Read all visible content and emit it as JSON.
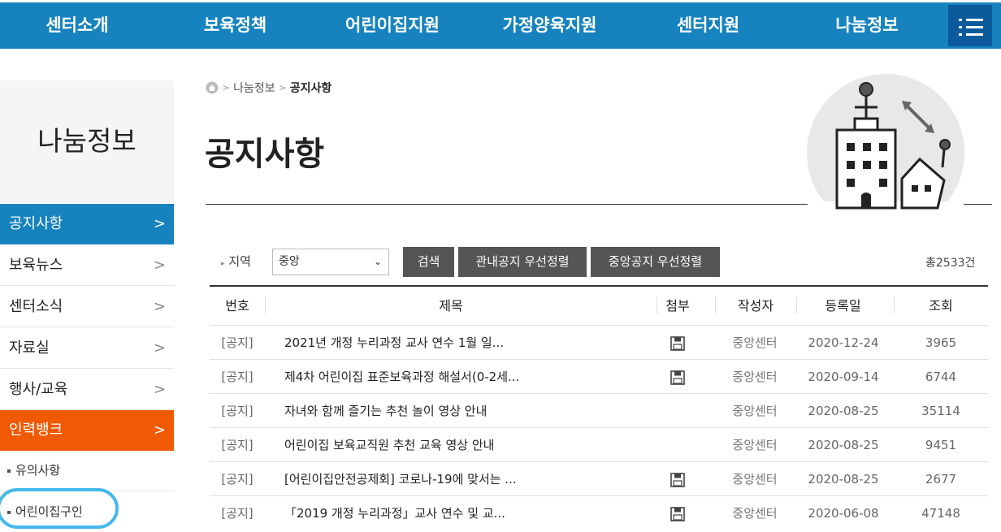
{
  "top_nav": {
    "items": [
      "센터소개",
      "보육정책",
      "어린이집지원",
      "가정양육지원",
      "센터지원",
      "나눔정보"
    ]
  },
  "sidebar": {
    "title": "나눔정보",
    "items": [
      {
        "label": "공지사항",
        "chevron": ">"
      },
      {
        "label": "보육뉴스",
        "chevron": ">"
      },
      {
        "label": "센터소식",
        "chevron": ">"
      },
      {
        "label": "자료실",
        "chevron": ">"
      },
      {
        "label": "행사/교육",
        "chevron": ">"
      },
      {
        "label": "인력뱅크",
        "chevron": ">"
      }
    ],
    "subitems": [
      {
        "label": "유의사항"
      },
      {
        "label": "어린이집구인"
      }
    ]
  },
  "breadcrumb": {
    "sep1": ">",
    "parent": "나눔정보",
    "sep2": ">",
    "current": "공지사항"
  },
  "page": {
    "title": "공지사항"
  },
  "filter": {
    "region_label": "지역",
    "region_value": "중앙",
    "caret": "⌄",
    "search_button": "검색",
    "sort_local_button": "관내공지 우선정렬",
    "sort_central_button": "중앙공지 우선정렬",
    "total": "총2533건"
  },
  "table": {
    "headers": {
      "num": "번호",
      "title": "제목",
      "attach": "첨부",
      "author": "작성자",
      "date": "등록일",
      "views": "조회"
    },
    "rows": [
      {
        "num": "[공지]",
        "title": "2021년 개정 누리과정 교사 연수 1월 일...",
        "author": "중앙센터",
        "date": "2020-12-24",
        "views": "3965"
      },
      {
        "num": "[공지]",
        "title": "제4차 어린이집 표준보육과정 해설서(0-2세...",
        "author": "중앙센터",
        "date": "2020-09-14",
        "views": "6744"
      },
      {
        "num": "[공지]",
        "title": "자녀와 함께 즐기는 추천 놀이 영상 안내",
        "author": "중앙센터",
        "date": "2020-08-25",
        "views": "35114"
      },
      {
        "num": "[공지]",
        "title": "어린이집 보육교직원 추천 교육 영상 안내",
        "author": "중앙센터",
        "date": "2020-08-25",
        "views": "9451"
      },
      {
        "num": "[공지]",
        "title": "[어린이집안전공제회] 코로나-19에 맞서는 ...",
        "author": "중앙센터",
        "date": "2020-08-25",
        "views": "2677"
      },
      {
        "num": "[공지]",
        "title": "「2019 개정 누리과정」교사 연수 및 교...",
        "author": "중앙센터",
        "date": "2020-06-08",
        "views": "47148"
      }
    ]
  },
  "colors": {
    "nav_blue": "#1683be",
    "menu_dark": "#0b5a9b",
    "active_orange": "#f05a05",
    "annotation": "#45b8ec"
  }
}
